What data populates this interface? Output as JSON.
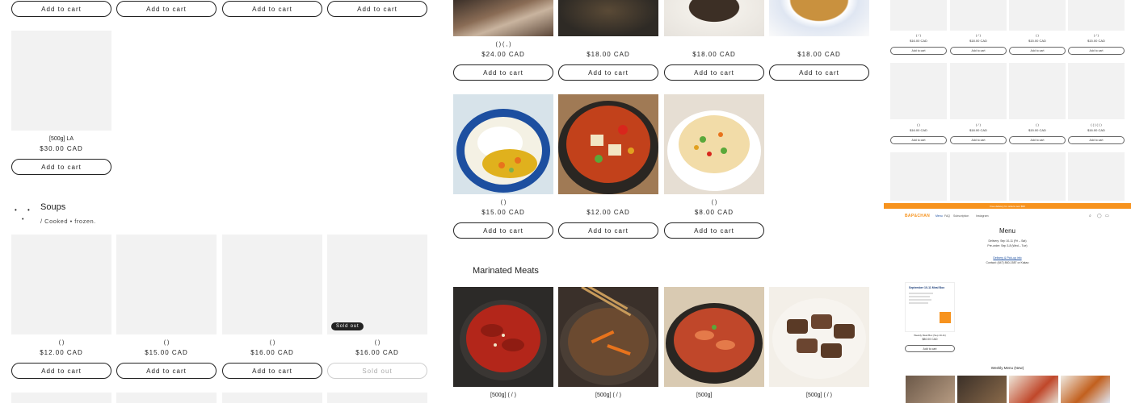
{
  "common": {
    "add_to_cart": "Add to cart",
    "sold_out": "Sold out"
  },
  "left": {
    "la_item": {
      "title": "[500g]        LA",
      "price": "$30.00 CAD"
    },
    "soups": {
      "title": "Soups",
      "desc": "/ Cooked • frozen.",
      "items": [
        {
          "title": "(    )",
          "price": "$12.00 CAD"
        },
        {
          "title": "(    )",
          "price": "$15.00 CAD"
        },
        {
          "title": "(    )",
          "price": "$16.00 CAD"
        },
        {
          "title": "(    )",
          "price": "$16.00 CAD"
        }
      ]
    }
  },
  "middle": {
    "row1": [
      {
        "title": "(    )   (       ,  )",
        "price": "$24.00 CAD"
      },
      {
        "title": "",
        "price": "$18.00 CAD"
      },
      {
        "title": "",
        "price": "$18.00 CAD"
      },
      {
        "title": "",
        "price": "$18.00 CAD"
      }
    ],
    "row2": [
      {
        "title": "(    )",
        "price": "$15.00 CAD"
      },
      {
        "title": "",
        "price": "$12.00 CAD"
      },
      {
        "title": "(    )",
        "price": "$8.00 CAD"
      }
    ],
    "marinated": {
      "title": "Marinated Meats",
      "items": [
        {
          "title": "[500g]             (     /    )"
        },
        {
          "title": "[500g]             (     /    )"
        },
        {
          "title": "[500g]"
        },
        {
          "title": "[500g]             (     /    )"
        }
      ]
    }
  },
  "mini": {
    "rows": [
      [
        "$16.00 CAD",
        "$18.00 CAD",
        "$15.00 CAD",
        "$15.00 CAD"
      ],
      [
        "$16.00 CAD",
        "$18.00 CAD",
        "$15.00 CAD",
        "$16.00 CAD"
      ]
    ],
    "titles": [
      [
        "(  /  )",
        "(  /  )",
        "(    )",
        "(  /  )"
      ],
      [
        "(    )",
        "(  /  )",
        "(    )",
        "(  (  )  (  )  )"
      ]
    ],
    "add_to_cart": "Add to cart",
    "banner": "Free delivery for orders over $99",
    "logo": "BAP&CHAN",
    "nav": [
      "Menu",
      "FAQ",
      "Subscription",
      "Instagram"
    ],
    "menu_title": "Menu",
    "delivery": "Delivery: Sep 10-11 (Fri – Sat)",
    "preorder": "Pre-order: Sep 3-8 (Wed – Tue)",
    "pickup_link": "Delivery & Pick-up info",
    "contact": "Contact: (647) 860-1587 or Kakao",
    "meal_box_title": "September 10-11 Meal Box",
    "meal_box_note": "Weekly Meal Box (Sep 10-11)",
    "meal_box_price": "$80.00 CAD",
    "weekly_menu": "Weekly Menu (New)",
    "accent": "#f7931e"
  }
}
